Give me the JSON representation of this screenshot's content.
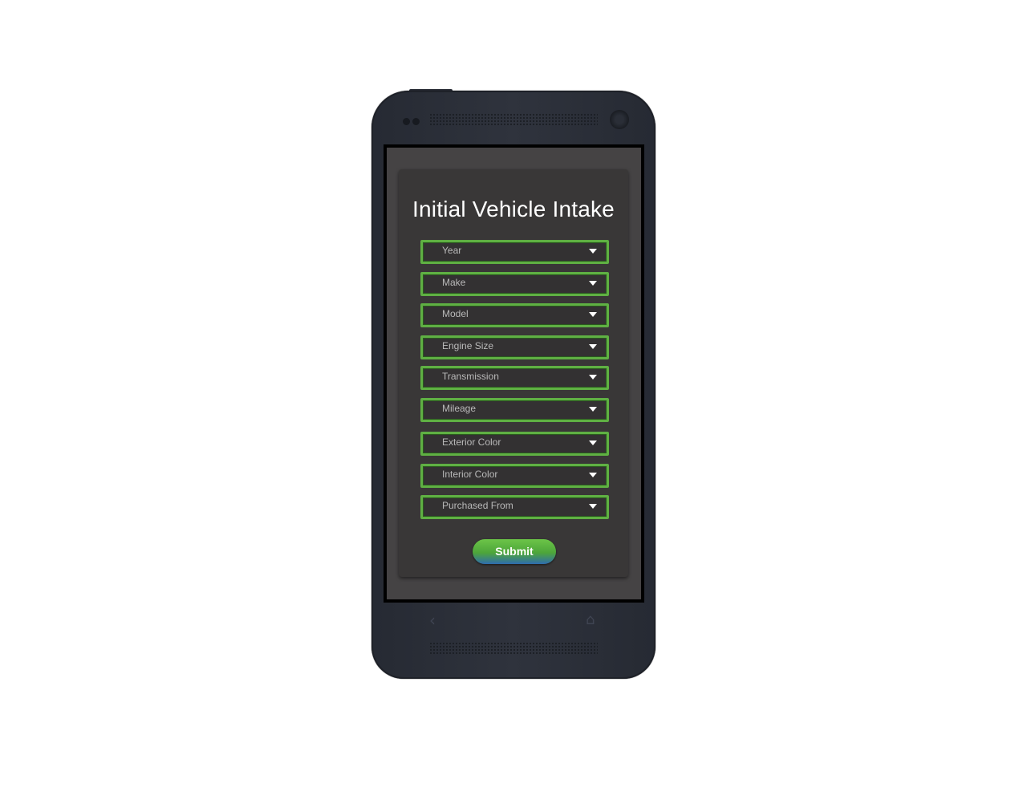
{
  "form": {
    "title": "Initial Vehicle Intake",
    "fields": [
      {
        "label": "Year"
      },
      {
        "label": "Make"
      },
      {
        "label": "Model"
      },
      {
        "label": "Engine Size"
      },
      {
        "label": "Transmission"
      },
      {
        "label": "Mileage"
      },
      {
        "label": "Exterior Color"
      },
      {
        "label": "Interior Color"
      },
      {
        "label": "Purchased From"
      }
    ],
    "submit_label": "Submit"
  },
  "nav": {
    "back_icon": "back-arrow-icon",
    "home_icon": "home-icon"
  },
  "colors": {
    "field_border": "#5fb043",
    "card_background": "#393737",
    "screen_background": "#454344",
    "submit_gradient_top": "#6cc548",
    "submit_gradient_bottom": "#2f6cae",
    "phone_body": "#2a2e37"
  }
}
